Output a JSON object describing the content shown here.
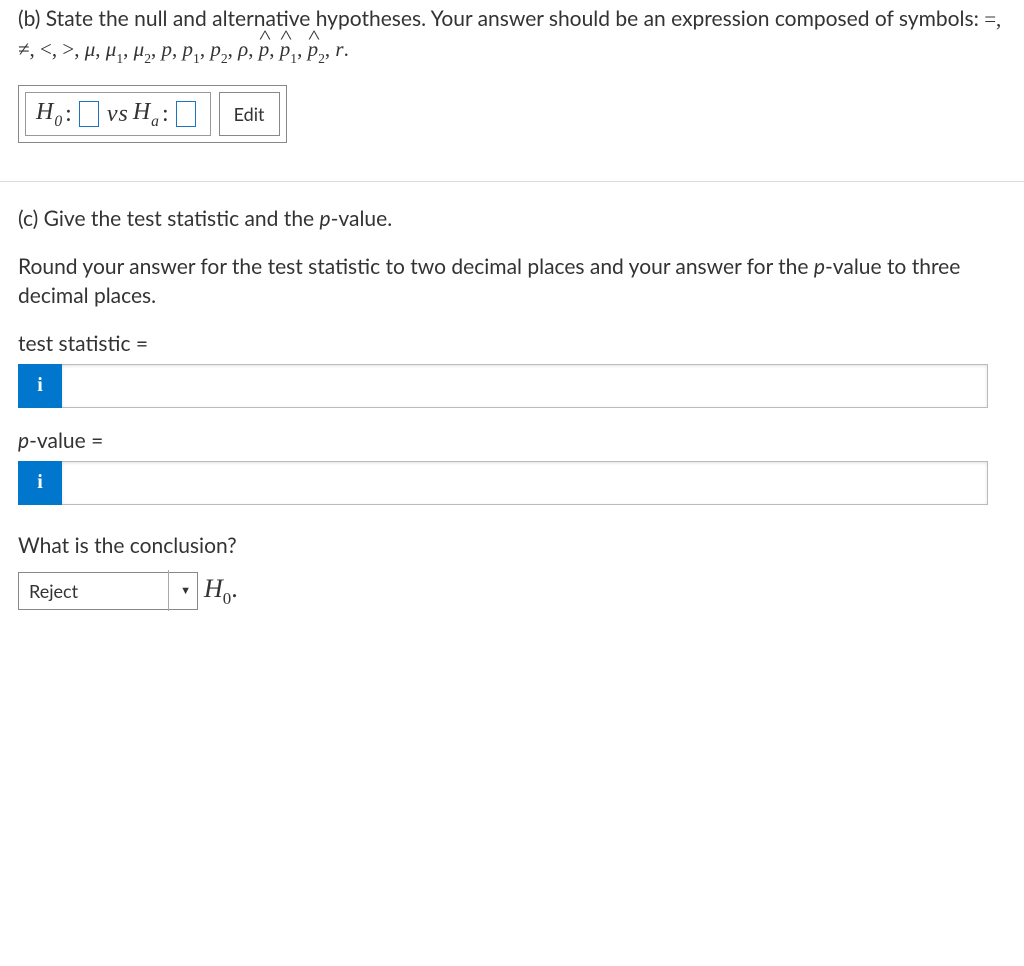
{
  "partB": {
    "prompt_plain": "(b) State the null and alternative hypotheses. Your answer should be an expression composed of symbols: ",
    "hyp": {
      "H0_label": "H",
      "H0_sub": "0",
      "colon": ":",
      "vs": "vs",
      "Ha_label": "H",
      "Ha_sub": "a"
    },
    "edit_label": "Edit"
  },
  "partC": {
    "prompt1": "(c) Give the test statistic and the ",
    "prompt1_pword": "p",
    "prompt1_tail": "-value.",
    "prompt2_head": "Round your answer for the test statistic to two decimal places and your answer for the ",
    "prompt2_pword": "p",
    "prompt2_tail": "-value to three decimal places.",
    "test_stat_label": "test statistic =",
    "pvalue_label_p": "p",
    "pvalue_label_tail": "-value =",
    "info_glyph": "i",
    "conclusion_q": "What is the conclusion?",
    "select_value": "Reject",
    "h0_text_H": "H",
    "h0_text_sub": "0",
    "h0_text_dot": "."
  }
}
